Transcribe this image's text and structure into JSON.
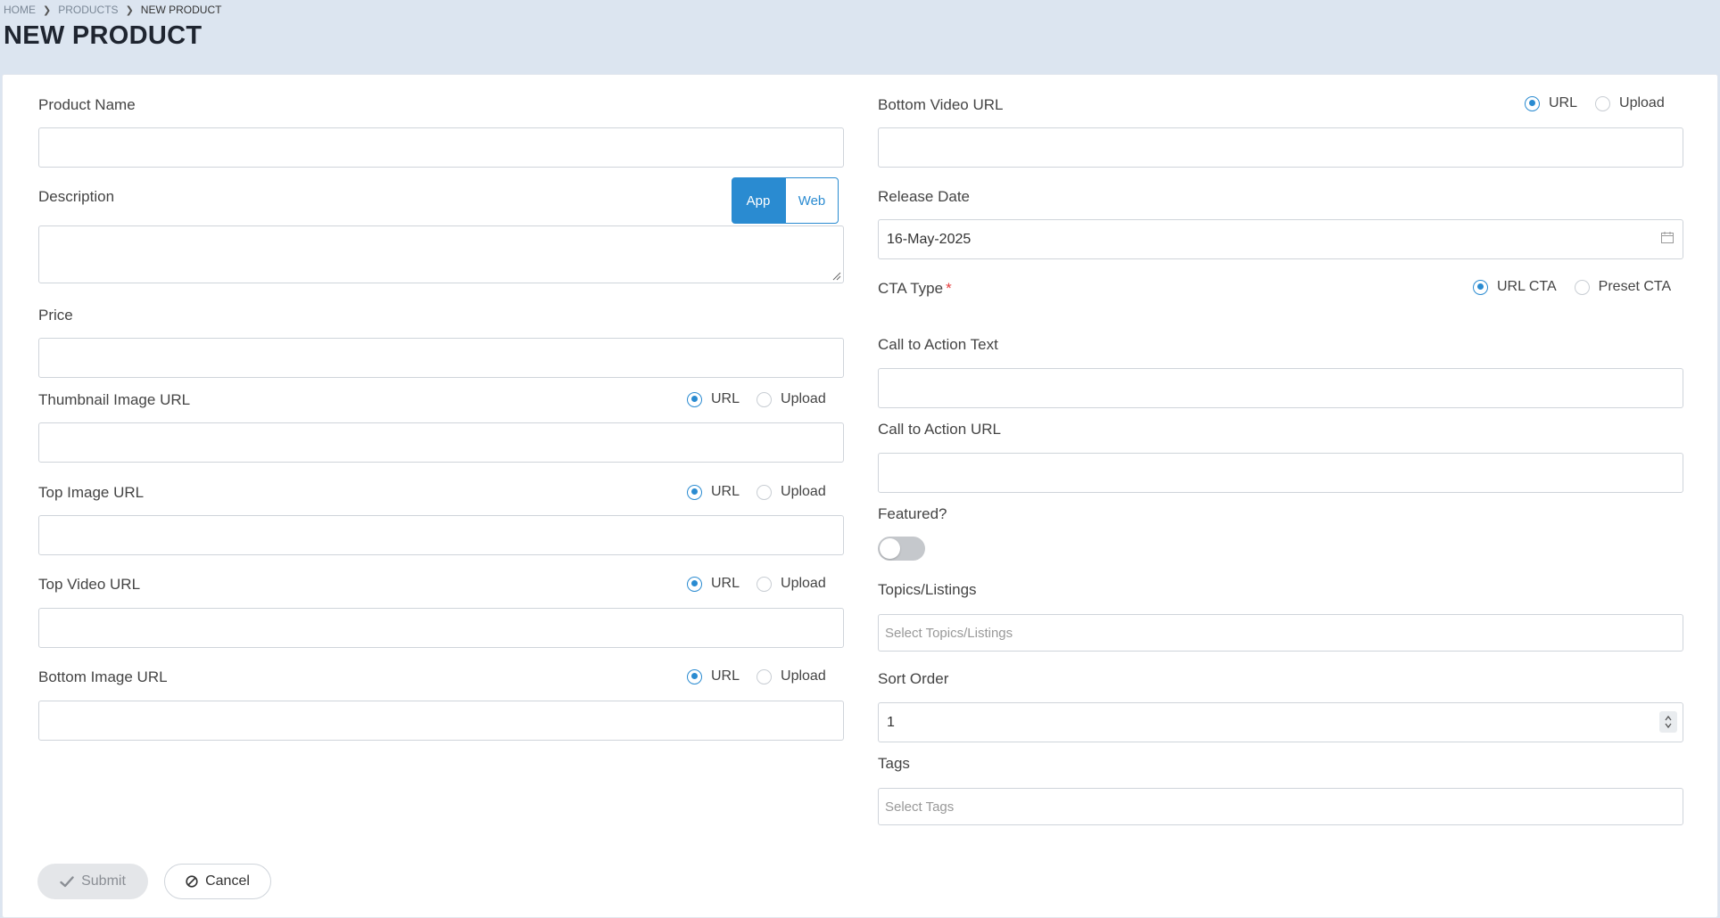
{
  "breadcrumb": {
    "home": "HOME",
    "products": "PRODUCTS",
    "current": "NEW PRODUCT"
  },
  "page_title": "NEW PRODUCT",
  "left": {
    "product_name": {
      "label": "Product Name",
      "value": ""
    },
    "description": {
      "label": "Description",
      "value": "",
      "mode_app": "App",
      "mode_web": "Web",
      "selected_mode": "App"
    },
    "price": {
      "label": "Price",
      "value": ""
    },
    "thumbnail_image": {
      "label": "Thumbnail Image URL",
      "opt_url": "URL",
      "opt_upload": "Upload",
      "selected": "URL",
      "value": ""
    },
    "top_image": {
      "label": "Top Image URL",
      "opt_url": "URL",
      "opt_upload": "Upload",
      "selected": "URL",
      "value": ""
    },
    "top_video": {
      "label": "Top Video URL",
      "opt_url": "URL",
      "opt_upload": "Upload",
      "selected": "URL",
      "value": ""
    },
    "bottom_image": {
      "label": "Bottom Image URL",
      "opt_url": "URL",
      "opt_upload": "Upload",
      "selected": "URL",
      "value": ""
    }
  },
  "right": {
    "bottom_video": {
      "label": "Bottom Video URL",
      "opt_url": "URL",
      "opt_upload": "Upload",
      "selected": "URL",
      "value": ""
    },
    "release_date": {
      "label": "Release Date",
      "value": "16-May-2025"
    },
    "cta_type": {
      "label": "CTA Type",
      "required_mark": "*",
      "opt_url": "URL CTA",
      "opt_preset": "Preset CTA",
      "selected": "URL CTA"
    },
    "cta_text": {
      "label": "Call to Action Text",
      "value": ""
    },
    "cta_url": {
      "label": "Call to Action URL",
      "value": ""
    },
    "featured": {
      "label": "Featured?",
      "on": false
    },
    "topics": {
      "label": "Topics/Listings",
      "placeholder": "Select Topics/Listings"
    },
    "sort_order": {
      "label": "Sort Order",
      "value": "1"
    },
    "tags": {
      "label": "Tags",
      "placeholder": "Select Tags"
    }
  },
  "actions": {
    "submit": "Submit",
    "cancel": "Cancel"
  },
  "colors": {
    "accent": "#2a8bd1",
    "page_bg": "#dce5f0",
    "required": "#e53e3e"
  }
}
